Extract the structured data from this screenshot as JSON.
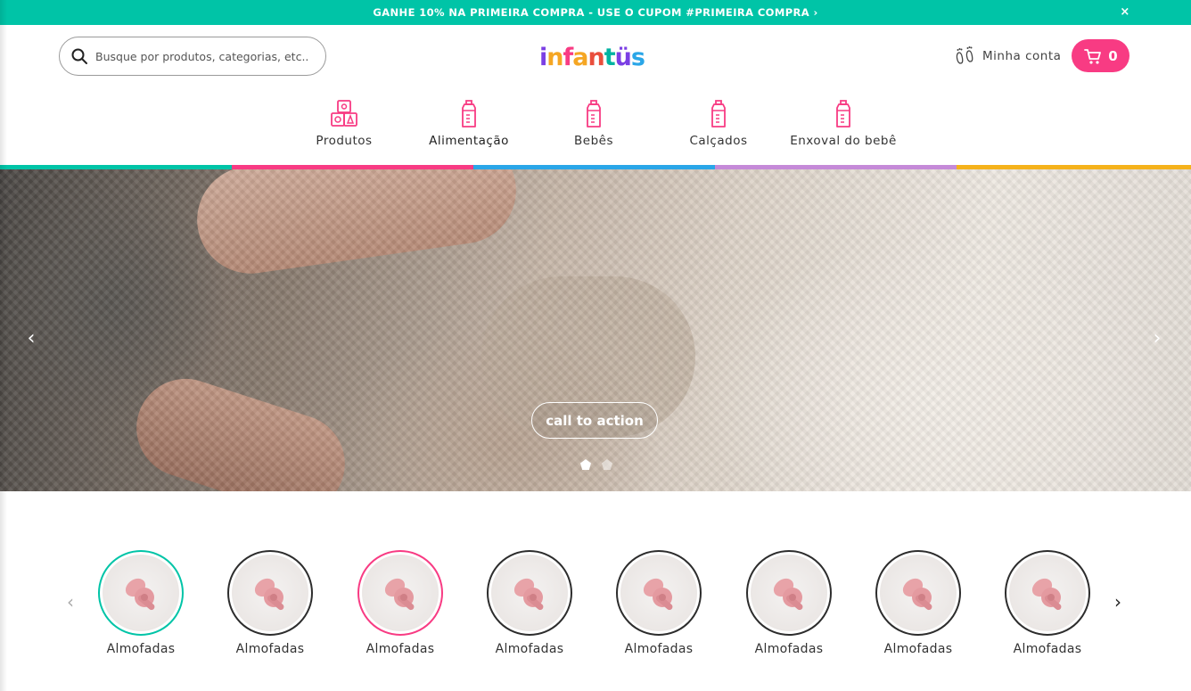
{
  "promo": {
    "text": "GANHE 10% NA PRIMEIRA COMPRA - USE O CUPOM #PRIMEIRA COMPRA ›",
    "close": "×",
    "color": "#00c4a7"
  },
  "header": {
    "search_placeholder": "Busque por produtos, categorias, etc...",
    "logo": [
      "i",
      "n",
      "f",
      "a",
      "n",
      "t",
      "ü",
      "s"
    ],
    "logo_colors": [
      "#7b3fe4",
      "#f5a623",
      "#f83b83",
      "#f5a623",
      "#e94e3c",
      "#00b3a1",
      "#7b3fe4",
      "#2aa6e8"
    ],
    "account_label": "Minha conta",
    "cart_count": "0",
    "cart_color": "#f83b83"
  },
  "nav": {
    "items": [
      {
        "label": "Produtos",
        "icon": "toy-blocks-icon"
      },
      {
        "label": "Alimentação",
        "icon": "baby-bottle-icon"
      },
      {
        "label": "Bebês",
        "icon": "baby-bottle-icon"
      },
      {
        "label": "Calçados",
        "icon": "baby-bottle-icon"
      },
      {
        "label": "Enxoval do bebê",
        "icon": "baby-bottle-icon"
      }
    ],
    "strip_colors": [
      "#00c4a7",
      "#f83b83",
      "#2aa6e8",
      "#c58ad8",
      "#f5b21b"
    ]
  },
  "hero": {
    "cta_label": "call to action",
    "prev": "‹",
    "next": "›",
    "slide_count": 2,
    "active_slide": 1
  },
  "categories": {
    "prev": "‹",
    "next": "›",
    "items": [
      {
        "label": "Almofadas",
        "ring_color": "#00c4a7"
      },
      {
        "label": "Almofadas",
        "ring_color": "#2d2d2d"
      },
      {
        "label": "Almofadas",
        "ring_color": "#f83b83"
      },
      {
        "label": "Almofadas",
        "ring_color": "#2d2d2d"
      },
      {
        "label": "Almofadas",
        "ring_color": "#2d2d2d"
      },
      {
        "label": "Almofadas",
        "ring_color": "#2d2d2d"
      },
      {
        "label": "Almofadas",
        "ring_color": "#2d2d2d"
      },
      {
        "label": "Almofadas",
        "ring_color": "#2d2d2d"
      }
    ]
  }
}
